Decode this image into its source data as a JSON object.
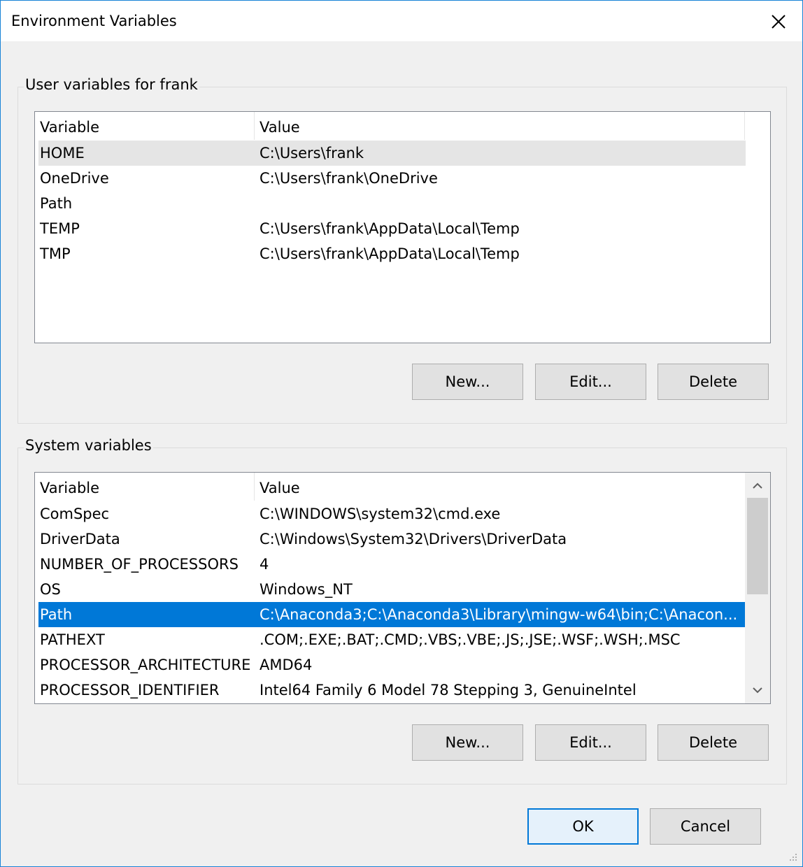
{
  "window": {
    "title": "Environment Variables"
  },
  "user_section": {
    "legend": "User variables for frank",
    "columns": {
      "variable": "Variable",
      "value": "Value"
    },
    "rows": [
      {
        "variable": "HOME",
        "value": "C:\\Users\\frank"
      },
      {
        "variable": "OneDrive",
        "value": "C:\\Users\\frank\\OneDrive"
      },
      {
        "variable": "Path",
        "value": ""
      },
      {
        "variable": "TEMP",
        "value": "C:\\Users\\frank\\AppData\\Local\\Temp"
      },
      {
        "variable": "TMP",
        "value": "C:\\Users\\frank\\AppData\\Local\\Temp"
      }
    ],
    "buttons": {
      "new": "New...",
      "edit": "Edit...",
      "delete": "Delete"
    }
  },
  "system_section": {
    "legend": "System variables",
    "columns": {
      "variable": "Variable",
      "value": "Value"
    },
    "rows": [
      {
        "variable": "ComSpec",
        "value": "C:\\WINDOWS\\system32\\cmd.exe"
      },
      {
        "variable": "DriverData",
        "value": "C:\\Windows\\System32\\Drivers\\DriverData"
      },
      {
        "variable": "NUMBER_OF_PROCESSORS",
        "value": "4"
      },
      {
        "variable": "OS",
        "value": "Windows_NT"
      },
      {
        "variable": "Path",
        "value": "C:\\Anaconda3;C:\\Anaconda3\\Library\\mingw-w64\\bin;C:\\Anacon..."
      },
      {
        "variable": "PATHEXT",
        "value": ".COM;.EXE;.BAT;.CMD;.VBS;.VBE;.JS;.JSE;.WSF;.WSH;.MSC"
      },
      {
        "variable": "PROCESSOR_ARCHITECTURE",
        "value": "AMD64"
      },
      {
        "variable": "PROCESSOR_IDENTIFIER",
        "value": "Intel64 Family 6 Model 78 Stepping 3, GenuineIntel"
      }
    ],
    "buttons": {
      "new": "New...",
      "edit": "Edit...",
      "delete": "Delete"
    }
  },
  "dialog_buttons": {
    "ok": "OK",
    "cancel": "Cancel"
  },
  "icons": {
    "close": "close-icon",
    "scroll_up": "chevron-up-icon",
    "scroll_down": "chevron-down-icon",
    "grip": "resize-grip-icon"
  },
  "colors": {
    "selection": "#0078d7",
    "window_border": "#1883d7",
    "hover_row": "#e5e5e5"
  }
}
